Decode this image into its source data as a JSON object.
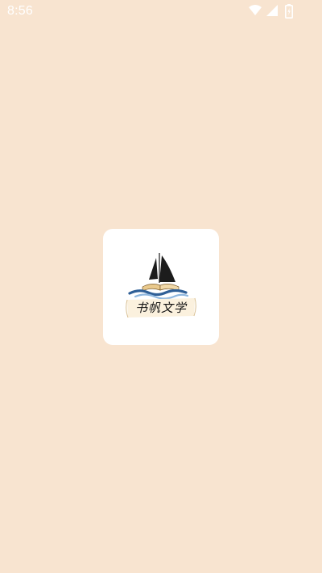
{
  "status_bar": {
    "time": "8:56",
    "icons": [
      "wifi-icon",
      "cellular-signal-icon",
      "battery-icon"
    ]
  },
  "splash": {
    "logo_name": "书帆文学",
    "icon": "sailboat-book-logo"
  },
  "colors": {
    "background": "#f8e4d0",
    "logo_tile": "#ffffff",
    "sail": "#1c1c1c",
    "wave_dark": "#2f5f96",
    "wave_light": "#8fb7de",
    "book_page": "#f1d9a8",
    "status_text": "#ffffff"
  }
}
